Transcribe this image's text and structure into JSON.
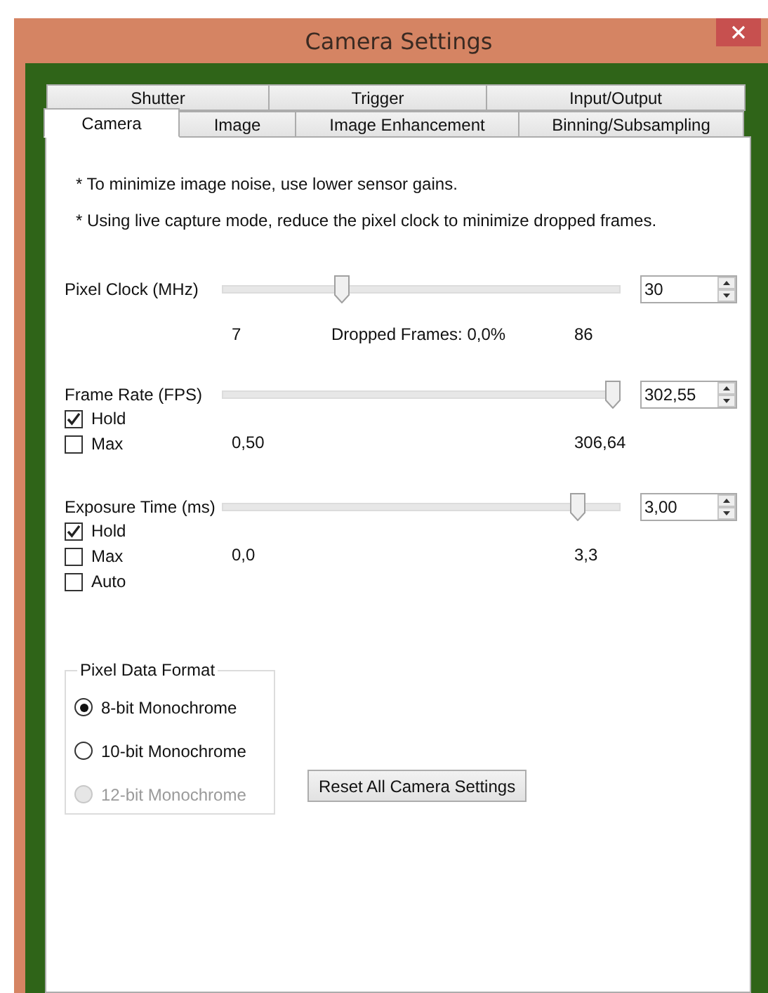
{
  "window": {
    "title": "Camera Settings"
  },
  "tab_rows": [
    [
      {
        "label": "Shutter",
        "selected": false
      },
      {
        "label": "Trigger",
        "selected": false
      },
      {
        "label": "Input/Output",
        "selected": false
      }
    ],
    [
      {
        "label": "Camera",
        "selected": true
      },
      {
        "label": "Image",
        "selected": false
      },
      {
        "label": "Image Enhancement",
        "selected": false
      },
      {
        "label": "Binning/Subsampling",
        "selected": false
      }
    ]
  ],
  "notes": [
    "* To minimize image noise, use lower sensor gains.",
    "* Using live capture mode, reduce the pixel clock to minimize dropped frames."
  ],
  "sliders": [
    {
      "label": "Pixel Clock (MHz)",
      "level": 0.3,
      "value": "30",
      "min": "7",
      "max": "86",
      "status": "Dropped Frames: 0,0%"
    },
    {
      "label": "Frame Rate (FPS)",
      "level": 0.98,
      "value": "302,55",
      "min": "0,50",
      "max": "306,64",
      "options": [
        {
          "label": "Hold",
          "checked": true
        },
        {
          "label": "Max",
          "checked": false
        }
      ]
    },
    {
      "label": "Exposure Time (ms)",
      "level": 0.89,
      "value": "3,00",
      "min": "0,0",
      "max": "3,3",
      "options": [
        {
          "label": "Hold",
          "checked": true
        },
        {
          "label": "Max",
          "checked": false
        },
        {
          "label": "Auto",
          "checked": false
        }
      ]
    }
  ],
  "pixel_data_format": {
    "title": "Pixel Data Format",
    "options": [
      {
        "label": "8-bit Monochrome",
        "selected": true,
        "disabled": false
      },
      {
        "label": "10-bit Monochrome",
        "selected": false,
        "disabled": false
      },
      {
        "label": "12-bit Monochrome",
        "selected": false,
        "disabled": true
      }
    ]
  },
  "reset_button": "Reset All Camera Settings"
}
